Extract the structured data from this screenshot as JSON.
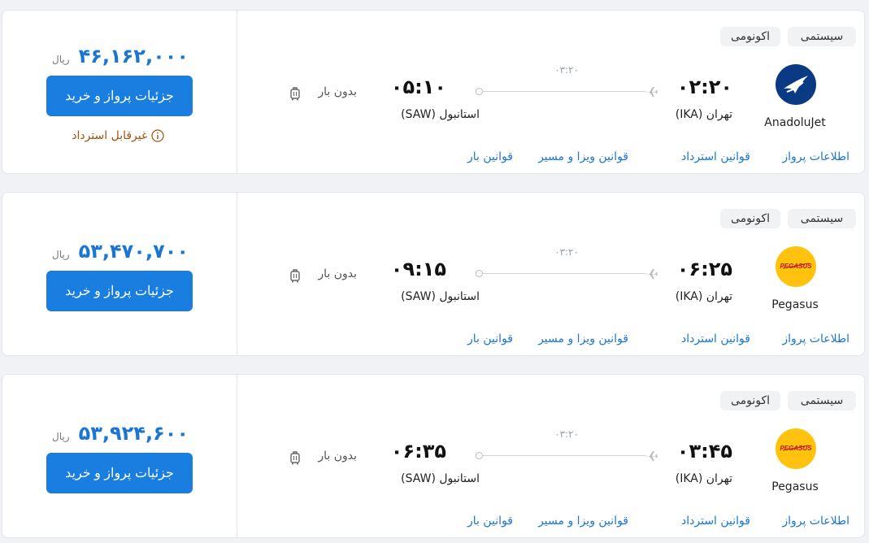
{
  "flights": [
    {
      "tags": [
        "سیستمی",
        "اکونومی"
      ],
      "airline": {
        "name": "AnadoluJet",
        "logo_icon": "anadolujet-logo-icon"
      },
      "departure": {
        "time": "۰۲:۲۰",
        "city": "تهران (IKA)"
      },
      "arrival": {
        "time": "۰۵:۱۰",
        "city": "استانبول (SAW)"
      },
      "duration": "۰۳:۲۰",
      "baggage": "بدون بار",
      "links": [
        "اطلاعات پرواز",
        "قوانین استرداد",
        "قوانین ویزا و مسیر",
        "قوانین بار"
      ],
      "price": "۴۶,۱۶۲,۰۰۰",
      "currency": "ریال",
      "buy_label": "جزئیات پرواز و خرید",
      "refund_status": "غیرقابل استرداد"
    },
    {
      "tags": [
        "سیستمی",
        "اکونومی"
      ],
      "airline": {
        "name": "Pegasus",
        "logo_icon": "pegasus-logo-icon"
      },
      "departure": {
        "time": "۰۶:۲۵",
        "city": "تهران (IKA)"
      },
      "arrival": {
        "time": "۰۹:۱۵",
        "city": "استانبول (SAW)"
      },
      "duration": "۰۳:۲۰",
      "baggage": "بدون بار",
      "links": [
        "اطلاعات پرواز",
        "قوانین استرداد",
        "قوانین ویزا و مسیر",
        "قوانین بار"
      ],
      "price": "۵۳,۴۷۰,۷۰۰",
      "currency": "ریال",
      "buy_label": "جزئیات پرواز و خرید"
    },
    {
      "tags": [
        "سیستمی",
        "اکونومی"
      ],
      "airline": {
        "name": "Pegasus",
        "logo_icon": "pegasus-logo-icon"
      },
      "departure": {
        "time": "۰۳:۴۵",
        "city": "تهران (IKA)"
      },
      "arrival": {
        "time": "۰۶:۳۵",
        "city": "استانبول (SAW)"
      },
      "duration": "۰۳:۲۰",
      "baggage": "بدون بار",
      "links": [
        "اطلاعات پرواز",
        "قوانین استرداد",
        "قوانین ویزا و مسیر",
        "قوانین بار"
      ],
      "price": "۵۳,۹۲۴,۶۰۰",
      "currency": "ریال",
      "buy_label": "جزئیات پرواز و خرید"
    }
  ],
  "colors": {
    "accent": "#1a7de0",
    "link": "#1a76d2",
    "refund": "#a0530f",
    "anadolu": "#0b3a84",
    "pegasus": "#ffc20e"
  }
}
